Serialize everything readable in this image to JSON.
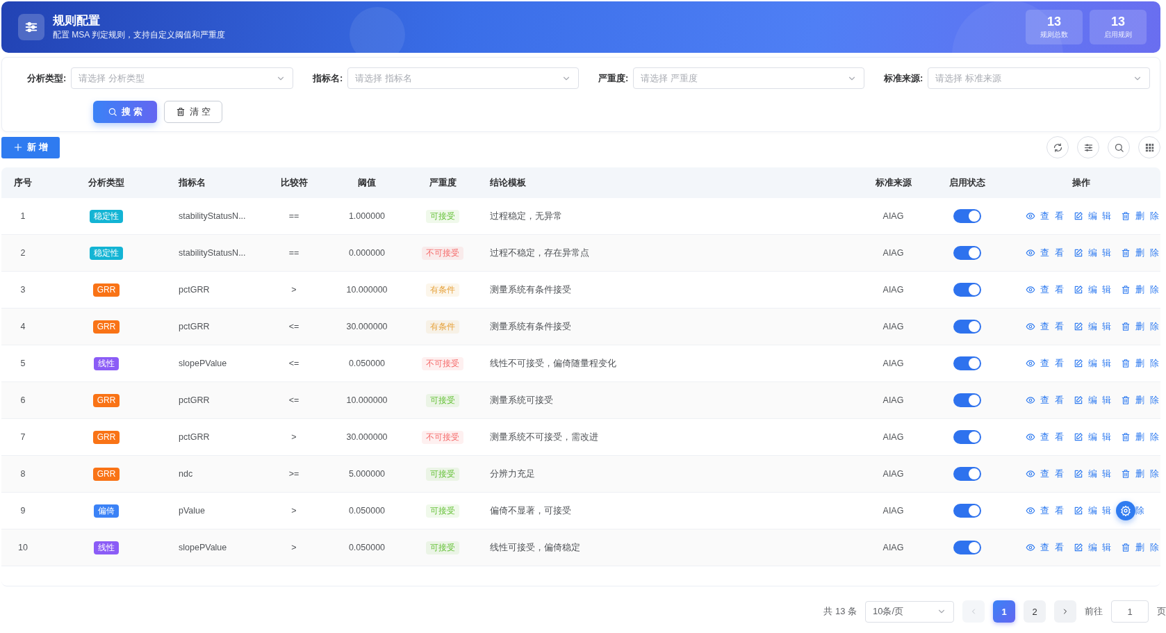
{
  "header": {
    "title": "规则配置",
    "subtitle": "配置 MSA 判定规则，支持自定义阈值和严重度",
    "stats": [
      {
        "value": "13",
        "label": "规则总数"
      },
      {
        "value": "13",
        "label": "启用规则"
      }
    ]
  },
  "filters": [
    {
      "label": "分析类型:",
      "placeholder": "请选择 分析类型"
    },
    {
      "label": "指标名:",
      "placeholder": "请选择 指标名"
    },
    {
      "label": "严重度:",
      "placeholder": "请选择 严重度"
    },
    {
      "label": "标准来源:",
      "placeholder": "请选择 标准来源"
    }
  ],
  "filter_buttons": [
    {
      "label": "搜 索",
      "kind": "search"
    },
    {
      "label": "清 空",
      "kind": "clear"
    }
  ],
  "add_button": "新 增",
  "table": {
    "columns": [
      "序号",
      "分析类型",
      "指标名",
      "比较符",
      "阈值",
      "严重度",
      "结论模板",
      "标准来源",
      "启用状态",
      "操作"
    ],
    "rows": [
      {
        "index": "1",
        "type": {
          "text": "稳定性",
          "color": "#13b4d4"
        },
        "metric": "stabilityStatusN...",
        "op": "==",
        "threshold": "1.000000",
        "severity": {
          "text": "可接受",
          "color": "#67c23a"
        },
        "template": "过程稳定，无异常",
        "source": "AIAG",
        "on": true,
        "actions": [
          "查 看",
          "编 辑",
          "删 除"
        ]
      },
      {
        "index": "2",
        "type": {
          "text": "稳定性",
          "color": "#13b4d4"
        },
        "metric": "stabilityStatusN...",
        "op": "==",
        "threshold": "0.000000",
        "severity": {
          "text": "不可接受",
          "color": "#f56c6c"
        },
        "template": "过程不稳定，存在异常点",
        "source": "AIAG",
        "on": true,
        "actions": [
          "查 看",
          "编 辑",
          "删 除"
        ]
      },
      {
        "index": "3",
        "type": {
          "text": "GRR",
          "color": "#f97316"
        },
        "metric": "pctGRR",
        "op": ">",
        "threshold": "10.000000",
        "severity": {
          "text": "有条件",
          "color": "#e6a23c"
        },
        "template": "测量系统有条件接受",
        "source": "AIAG",
        "on": true,
        "actions": [
          "查 看",
          "编 辑",
          "删 除"
        ]
      },
      {
        "index": "4",
        "type": {
          "text": "GRR",
          "color": "#f97316"
        },
        "metric": "pctGRR",
        "op": "<=",
        "threshold": "30.000000",
        "severity": {
          "text": "有条件",
          "color": "#e6a23c"
        },
        "template": "测量系统有条件接受",
        "source": "AIAG",
        "on": true,
        "actions": [
          "查 看",
          "编 辑",
          "删 除"
        ]
      },
      {
        "index": "5",
        "type": {
          "text": "线性",
          "color": "#8b5cf6"
        },
        "metric": "slopePValue",
        "op": "<=",
        "threshold": "0.050000",
        "severity": {
          "text": "不可接受",
          "color": "#f56c6c"
        },
        "template": "线性不可接受，偏倚随量程变化",
        "source": "AIAG",
        "on": true,
        "actions": [
          "查 看",
          "编 辑",
          "删 除"
        ]
      },
      {
        "index": "6",
        "type": {
          "text": "GRR",
          "color": "#f97316"
        },
        "metric": "pctGRR",
        "op": "<=",
        "threshold": "10.000000",
        "severity": {
          "text": "可接受",
          "color": "#67c23a"
        },
        "template": "测量系统可接受",
        "source": "AIAG",
        "on": true,
        "actions": [
          "查 看",
          "编 辑",
          "删 除"
        ]
      },
      {
        "index": "7",
        "type": {
          "text": "GRR",
          "color": "#f97316"
        },
        "metric": "pctGRR",
        "op": ">",
        "threshold": "30.000000",
        "severity": {
          "text": "不可接受",
          "color": "#f56c6c"
        },
        "template": "测量系统不可接受，需改进",
        "source": "AIAG",
        "on": true,
        "actions": [
          "查 看",
          "编 辑",
          "删 除"
        ]
      },
      {
        "index": "8",
        "type": {
          "text": "GRR",
          "color": "#f97316"
        },
        "metric": "ndc",
        "op": ">=",
        "threshold": "5.000000",
        "severity": {
          "text": "可接受",
          "color": "#67c23a"
        },
        "template": "分辨力充足",
        "source": "AIAG",
        "on": true,
        "actions": [
          "查 看",
          "编 辑",
          "删 除"
        ]
      },
      {
        "index": "9",
        "type": {
          "text": "偏倚",
          "color": "#3b82f6"
        },
        "metric": "pValue",
        "op": ">",
        "threshold": "0.050000",
        "severity": {
          "text": "可接受",
          "color": "#67c23a"
        },
        "template": "偏倚不显著，可接受",
        "source": "AIAG",
        "on": true,
        "actions": [
          "查 看",
          "编 辑",
          "除"
        ],
        "delete_icon_covered": true
      },
      {
        "index": "10",
        "type": {
          "text": "线性",
          "color": "#8b5cf6"
        },
        "metric": "slopePValue",
        "op": ">",
        "threshold": "0.050000",
        "severity": {
          "text": "可接受",
          "color": "#67c23a"
        },
        "template": "线性可接受，偏倚稳定",
        "source": "AIAG",
        "on": true,
        "actions": [
          "查 看",
          "编 辑",
          "删 除"
        ]
      }
    ]
  },
  "pagination": {
    "total": "共 13 条",
    "page_size": "10条/页",
    "prev_disabled": true,
    "pages": [
      {
        "label": "1",
        "selected": true
      },
      {
        "label": "2",
        "selected": false
      }
    ],
    "goto_label": "前往",
    "goto_value": "1",
    "page_suffix": "页"
  }
}
